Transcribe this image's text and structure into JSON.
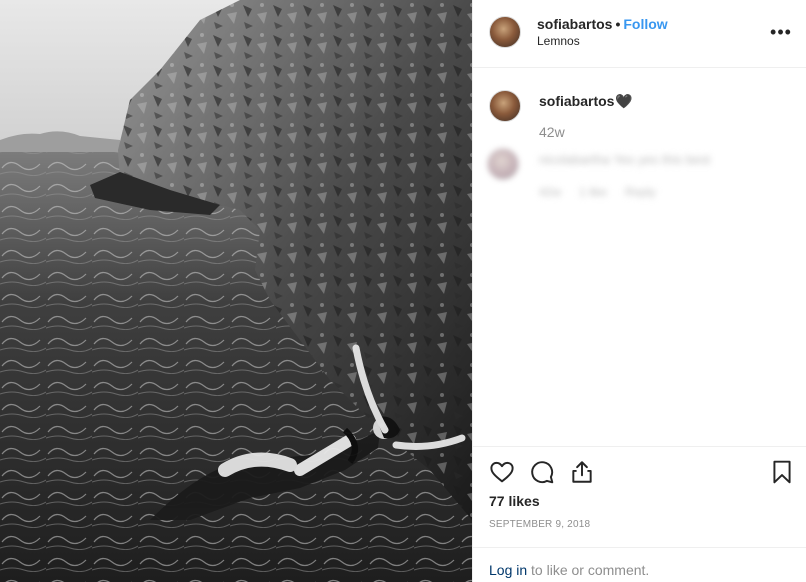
{
  "post": {
    "username": "sofiabartos",
    "follow_label": "Follow",
    "location": "Lemnos",
    "more_label": "•••"
  },
  "caption": {
    "username": "sofiabartos",
    "emoji": "🖤",
    "time": "42w"
  },
  "comment": {
    "text": "nicolabartha Yes yes this best",
    "meta": [
      "42w",
      "1 like",
      "Reply"
    ]
  },
  "actions": {
    "likes": "77 likes",
    "date": "SEPTEMBER 9, 2018"
  },
  "footer": {
    "login_label": "Log in",
    "login_suffix": " to like or comment."
  },
  "colors": {
    "accent": "#3897f0",
    "link": "#00376b",
    "muted": "#8e8e8e",
    "text": "#262626",
    "border": "#efefef"
  },
  "icons": [
    "more-options-icon",
    "heart-icon",
    "comment-icon",
    "share-icon",
    "bookmark-icon"
  ]
}
